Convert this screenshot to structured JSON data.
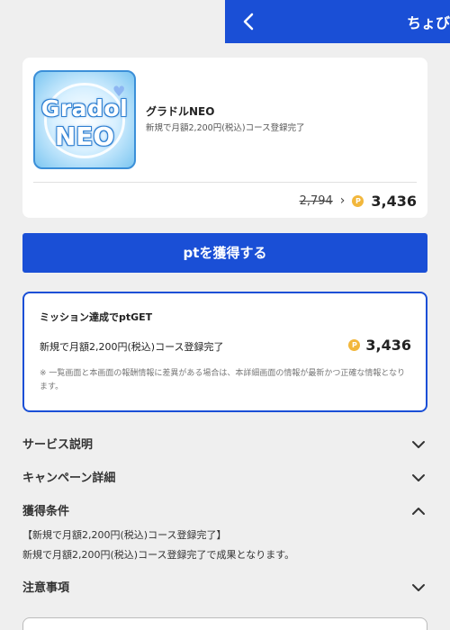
{
  "header": {
    "title": "ちょび",
    "back_icon": "chevron-left-icon"
  },
  "offer": {
    "logo_line1": "Gradol",
    "logo_line2": "NEO",
    "name": "グラドルNEO",
    "description": "新規で月額2,200円(税込)コース登録完了",
    "old_points": "2,794",
    "arrow": "›",
    "coin_symbol": "P",
    "points": "3,436"
  },
  "cta": {
    "label": "ptを獲得する"
  },
  "mission": {
    "title": "ミッション達成でptGET",
    "condition": "新規で月額2,200円(税込)コース登録完了",
    "points": "3,436",
    "coin_symbol": "P",
    "note": "※ 一覧画面と本画面の報酬情報に差異がある場合は、本詳細画面の情報が最新かつ正確な情報となります。"
  },
  "sections": {
    "service": "サービス説明",
    "campaign": "キャンペーン詳細",
    "conditions": "獲得条件",
    "notes": "注意事項"
  },
  "conditions": {
    "line1": "【新規で月額2,200円(税込)コース登録完了】",
    "line2": "新規で月額2,200円(税込)コース登録完了で成果となります。"
  },
  "colors": {
    "primary": "#1a4fd6",
    "coin": "#f2b73c",
    "background": "#efefef"
  }
}
